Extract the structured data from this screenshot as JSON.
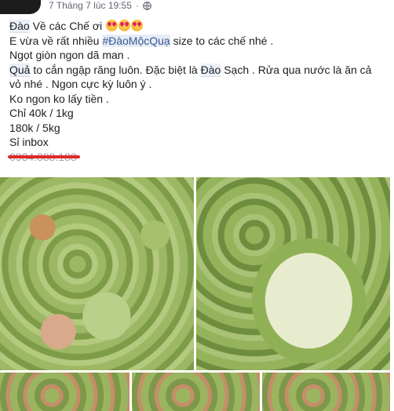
{
  "post": {
    "timestamp": "7 Tháng 7 lúc 19:55",
    "separator": "·",
    "privacy_icon": "globe-icon",
    "lines": {
      "l1_kw": "Đào",
      "l1_rest": " Về các Chế ơi ",
      "l2_pre": "E vừa về rất nhiều ",
      "l2_tag": "#ĐàoMộcQuạ",
      "l2_post": " size to các chế nhé .",
      "l3": "Ngọt giòn ngon dã man .",
      "l4_kw1": "Quả",
      "l4_mid": " to cắn ngập răng luôn. Đặc biệt là ",
      "l4_kw2": "Đào",
      "l4_rest": " Sạch . Rửa qua nước là ăn cả",
      "l5": "vỏ nhé . Ngon cực kỳ luôn ý .",
      "l6": "Ko ngon ko lấy tiền .",
      "l7": "Chỉ 40k / 1kg",
      "l8": "180k / 5kg",
      "l9": "Sỉ inbox",
      "l10_phone": "0934.888.188"
    },
    "emoji_icon": "heart-eyes-emoji-icon"
  },
  "colors": {
    "hashtag": "#385898",
    "meta": "#606770",
    "strike": "#e02a2a"
  }
}
